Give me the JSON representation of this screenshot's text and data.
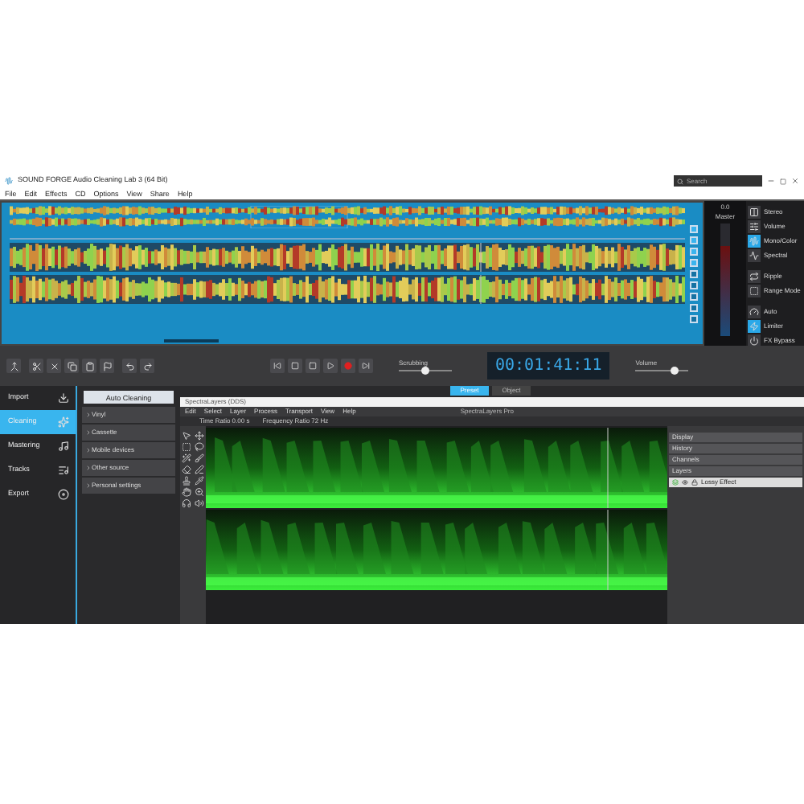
{
  "window": {
    "title": "SOUND FORGE Audio Cleaning Lab 3 (64 Bit)",
    "search": {
      "placeholder": "Search"
    }
  },
  "menu": [
    "File",
    "Edit",
    "Effects",
    "CD",
    "Options",
    "View",
    "Share",
    "Help"
  ],
  "meter": {
    "reading": "0.0",
    "label": "Master",
    "level": 0.8
  },
  "view_options": [
    {
      "label": "Stereo",
      "on": false
    },
    {
      "label": "Volume",
      "on": false
    },
    {
      "label": "Mono/Color",
      "on": true
    },
    {
      "label": "Spectral",
      "on": false
    },
    {
      "label": "Ripple",
      "on": false
    },
    {
      "label": "Range Mode",
      "on": false
    },
    {
      "label": "Auto",
      "on": false
    },
    {
      "label": "Limiter",
      "on": true
    },
    {
      "label": "FX Bypass",
      "on": false
    }
  ],
  "transport": {
    "scrubbing": {
      "label": "Scrubbing",
      "level": 0.5
    },
    "time": "00:01:41:11",
    "volume": {
      "label": "Volume",
      "level": 0.75
    }
  },
  "nav": [
    {
      "label": "Import",
      "selected": false
    },
    {
      "label": "Cleaning",
      "selected": true
    },
    {
      "label": "Mastering",
      "selected": false
    },
    {
      "label": "Tracks",
      "selected": false
    },
    {
      "label": "Export",
      "selected": false
    }
  ],
  "cleaning": {
    "button": "Auto Cleaning",
    "items": [
      "Vinyl",
      "Cassette",
      "Mobile devices",
      "Other source",
      "Personal settings"
    ]
  },
  "tabs": [
    {
      "label": "Preset",
      "selected": true
    },
    {
      "label": "Object",
      "selected": false
    }
  ],
  "spectralayers": {
    "window_title": "SpectraLayers (DDS)",
    "app_title": "SpectraLayers Pro",
    "menu": [
      "Edit",
      "Select",
      "Layer",
      "Process",
      "Transport",
      "View",
      "Help"
    ],
    "time_ratio": "Time Ratio 0.00 s",
    "frequency_ratio": "Frequency Ratio 72 Hz",
    "panels": [
      "Display",
      "History",
      "Channels",
      "Layers"
    ],
    "layer": "Lossy Effect"
  }
}
